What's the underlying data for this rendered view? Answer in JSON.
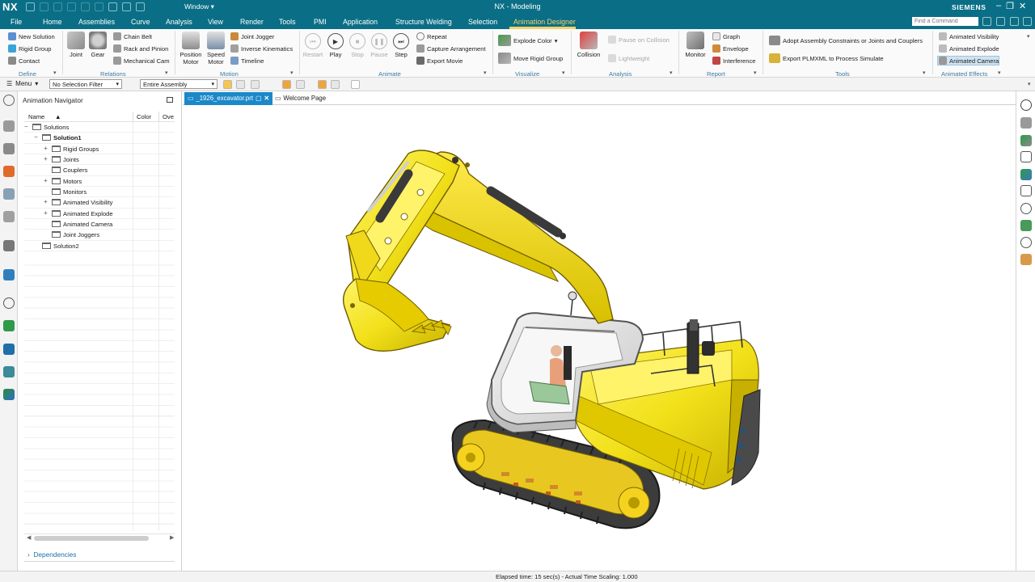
{
  "titlebar": {
    "logo": "NX",
    "window_menu": "Window",
    "title": "NX - Modeling",
    "brand": "SIEMENS"
  },
  "menu_tabs": [
    "File",
    "Home",
    "Assemblies",
    "Curve",
    "Analysis",
    "View",
    "Render",
    "Tools",
    "PMI",
    "Application",
    "Structure Welding",
    "Selection",
    "Animation Designer"
  ],
  "active_tab": "Animation Designer",
  "search": {
    "placeholder": "Find a Command"
  },
  "ribbon": {
    "define": {
      "label": "Define",
      "items": [
        "New Solution",
        "Rigid Group",
        "Contact"
      ]
    },
    "relations": {
      "label": "Relations",
      "big": [
        "Joint",
        "Gear"
      ],
      "items": [
        "Chain Belt",
        "Rack and Pinion",
        "Mechanical Cam"
      ]
    },
    "motion": {
      "label": "Motion",
      "big": [
        [
          "Position",
          "Motor"
        ],
        [
          "Speed",
          "Motor"
        ]
      ],
      "items": [
        "Joint Jogger",
        "Inverse Kinematics",
        "Timeline"
      ]
    },
    "animate": {
      "label": "Animate",
      "big": [
        "Restart",
        "Play",
        "Stop",
        "Pause",
        "Step"
      ],
      "items": [
        "Repeat",
        "Capture Arrangement",
        "Export Movie"
      ]
    },
    "visualize": {
      "label": "Visualize",
      "items": [
        "Explode Color",
        "Move Rigid Group"
      ]
    },
    "analysis": {
      "label": "Analysis",
      "big": [
        "Collision"
      ],
      "items": [
        "Pause on Collision",
        "Lightweight"
      ]
    },
    "report": {
      "label": "Report",
      "big": [
        "Monitor"
      ],
      "items": [
        "Graph",
        "Envelope",
        "Interference"
      ]
    },
    "tools": {
      "label": "Tools",
      "items": [
        "Adopt Assembly Constraints or Joints and Couplers",
        "Export PLMXML to Process Simulate"
      ]
    },
    "animated_effects": {
      "label": "Animated Effects",
      "items": [
        "Animated Visibility",
        "Animated Explode",
        "Animated Camera"
      ]
    }
  },
  "selection_bar": {
    "menu": "Menu",
    "filter": "No Selection Filter",
    "scope": "Entire Assembly"
  },
  "navigator": {
    "title": "Animation Navigator",
    "columns": [
      "Name",
      "Color",
      "Ove"
    ],
    "tree": [
      {
        "label": "Solutions",
        "level": 0,
        "expander": "−"
      },
      {
        "label": "Solution1",
        "level": 1,
        "expander": "−",
        "bold": true
      },
      {
        "label": "Rigid Groups",
        "level": 2,
        "expander": "+"
      },
      {
        "label": "Joints",
        "level": 2,
        "expander": "+"
      },
      {
        "label": "Couplers",
        "level": 2,
        "expander": ""
      },
      {
        "label": "Motors",
        "level": 2,
        "expander": "+"
      },
      {
        "label": "Monitors",
        "level": 2,
        "expander": ""
      },
      {
        "label": "Animated Visibility",
        "level": 2,
        "expander": "+"
      },
      {
        "label": "Animated Explode",
        "level": 2,
        "expander": "+"
      },
      {
        "label": "Animated Camera",
        "level": 2,
        "expander": ""
      },
      {
        "label": "Joint Joggers",
        "level": 2,
        "expander": ""
      },
      {
        "label": "Solution2",
        "level": 1,
        "expander": ""
      }
    ],
    "dependencies": "Dependencies"
  },
  "doc_tabs": [
    {
      "label": "_1926_excavator.prt",
      "active": true
    },
    {
      "label": "Welcome Page",
      "active": false
    }
  ],
  "status": "Elapsed time: 15 sec(s) - Actual Time Scaling: 1.000",
  "colors": {
    "titlebar": "#0a6f86",
    "accent_tab": "#f6d36a",
    "excavator_yellow": "#f2e11a",
    "track_dark": "#3c3c3c",
    "link_blue": "#1f6fa8"
  }
}
